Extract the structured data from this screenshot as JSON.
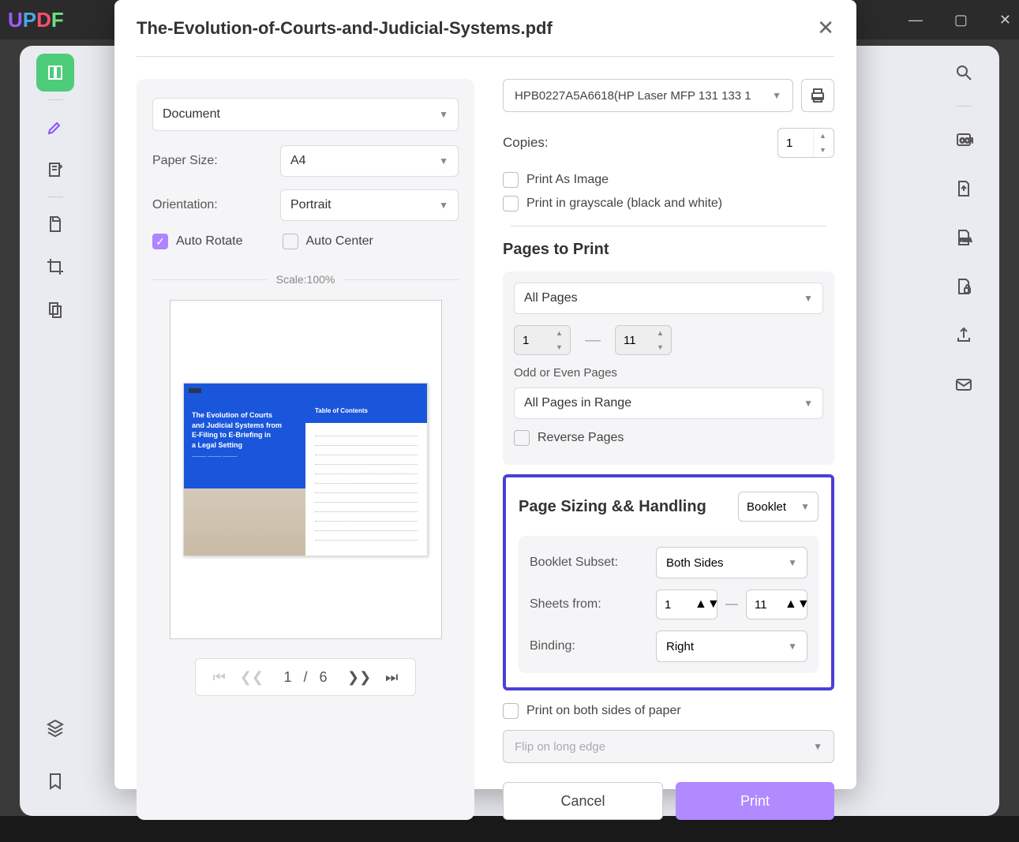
{
  "app": {
    "logo": {
      "u": "U",
      "p": "P",
      "d": "D",
      "f": "F"
    }
  },
  "dialog": {
    "title": "The-Evolution-of-Courts-and-Judicial-Systems.pdf",
    "left": {
      "mode": "Document",
      "paperSizeLabel": "Paper Size:",
      "paperSize": "A4",
      "orientationLabel": "Orientation:",
      "orientation": "Portrait",
      "autoRotate": "Auto Rotate",
      "autoCenter": "Auto Center",
      "scale": "Scale:100%",
      "preview": {
        "title1": "The Evolution of Courts",
        "title2": "and Judicial Systems from",
        "title3": "E-Filing to E-Briefing in",
        "title4": "a Legal Setting",
        "toc": "Table of Contents"
      },
      "pager": {
        "current": "1",
        "sep": "/",
        "total": "6"
      }
    },
    "right": {
      "printer": "HPB0227A5A6618(HP Laser MFP 131 133 1",
      "copiesLabel": "Copies:",
      "copies": "1",
      "printAsImage": "Print As Image",
      "grayscale": "Print in grayscale (black and white)",
      "pagesToPrint": "Pages to Print",
      "allPages": "All Pages",
      "rangeFrom": "1",
      "rangeTo": "11",
      "oddEvenLabel": "Odd or Even Pages",
      "oddEven": "All Pages in Range",
      "reversePages": "Reverse Pages",
      "sizing": {
        "title": "Page Sizing && Handling",
        "mode": "Booklet",
        "bookletSubsetLabel": "Booklet Subset:",
        "bookletSubset": "Both Sides",
        "sheetsFromLabel": "Sheets from:",
        "sheetsFrom": "1",
        "sheetsTo": "11",
        "bindingLabel": "Binding:",
        "binding": "Right"
      },
      "printBothSides": "Print on both sides of paper",
      "flip": "Flip on long edge",
      "cancel": "Cancel",
      "print": "Print"
    }
  }
}
